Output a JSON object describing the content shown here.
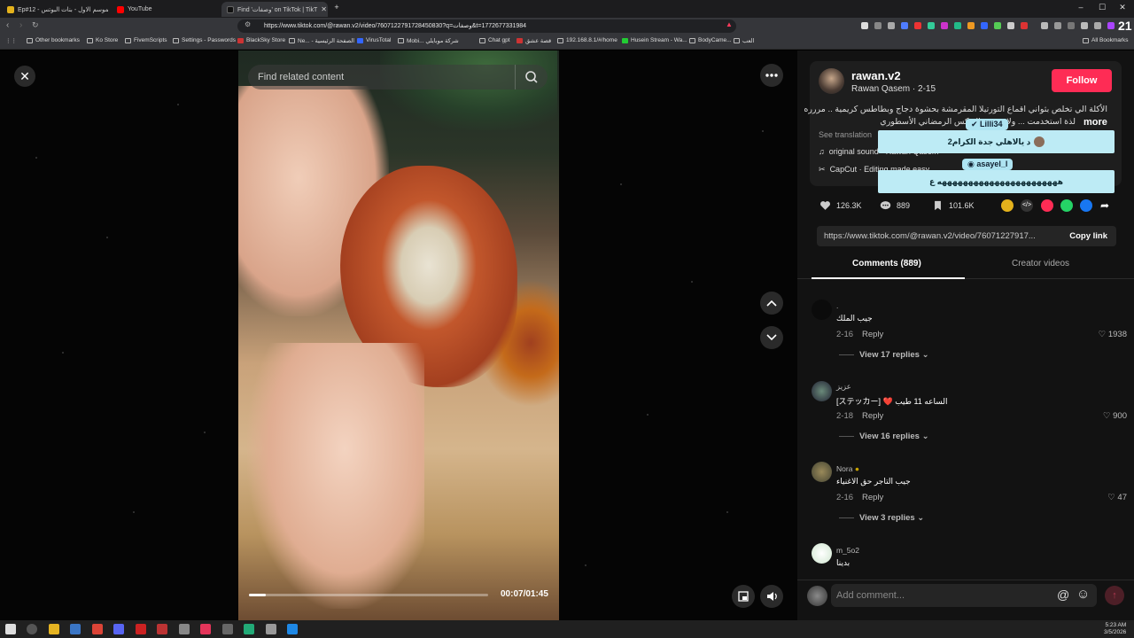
{
  "browser": {
    "tabs": [
      {
        "label": "Ep#12 - الموسم الاول - بنات البوتس"
      },
      {
        "label": "YouTube"
      },
      {
        "label": "Find 'وصفات' on TikTok | TikT"
      }
    ],
    "url": "https://www.tiktok.com/@rawan.v2/video/7607122791728450830?q=وصفات&t=1772677331984",
    "bookmarks": [
      "Other bookmarks",
      "Ko Store",
      "FivemScripts",
      "Settings - Passwords",
      "BlackSky Store",
      "Ne... - الصفحة الرئيسية",
      "VirusTotal",
      "Mobi... شركة موبايلي",
      "Chat gpt",
      "قصة عشق",
      "192.168.8.1/#/home",
      "Husein Stream - Wa...",
      "BodyCame...",
      "العب"
    ],
    "all_bookmarks": "All Bookmarks",
    "ext_count": "21"
  },
  "viewer": {
    "search_placeholder": "Find related content",
    "time": "00:07/01:45",
    "progress_fraction": 0.07
  },
  "post": {
    "username": "rawan.v2",
    "display_name": "Rawan Qasem · 2-15",
    "follow": "Follow",
    "desc_line1": "الأكلة الي تخلص بثواني اقماع التورتيلا المقرمشة بحشوة دجاج وبطاطس كريمية .. مررره",
    "desc_line2": "لذة استخدمت ... ولاقتوتون البوكس الرمضاني الأسطوري",
    "more": "more",
    "see_translation": "See translation",
    "sound": "original sound - Rawan Qasem",
    "capcut": "CapCut · Editing made easy",
    "likes": "126.3K",
    "comments": "889",
    "saves": "101.6K",
    "link": "https://www.tiktok.com/@rawan.v2/video/76071227917...",
    "copy_link": "Copy link",
    "tab_comments": "Comments (889)",
    "tab_creator": "Creator videos"
  },
  "overlays": {
    "user1": "Lilli34",
    "msg1": "د يالاهلي جدة الكرام2",
    "user2": "asayel_l",
    "msg2": "هههههههههههههههههههههههه ع"
  },
  "comments": [
    {
      "name": ".",
      "text": "جيب الملك",
      "date": "2-16",
      "reply": "Reply",
      "likes": "1938",
      "replies": "View 17 replies"
    },
    {
      "name": "عزيز",
      "text": "[ステッカー] ❤️ الساعه 11 طيب",
      "date": "2-18",
      "reply": "Reply",
      "likes": "900",
      "replies": "View 16 replies"
    },
    {
      "name": "Nora",
      "text": "جيب التاجر حق الاغنياء",
      "date": "2-16",
      "reply": "Reply",
      "likes": "47",
      "replies": "View 3 replies"
    },
    {
      "name": "m_5o2",
      "text": "بدينا"
    }
  ],
  "comment_input": "Add comment...",
  "clock": {
    "time": "5:23 AM",
    "date": "3/5/2026"
  },
  "colors": {
    "accent": "#fe2c55",
    "overlay": "#bdebf5"
  }
}
